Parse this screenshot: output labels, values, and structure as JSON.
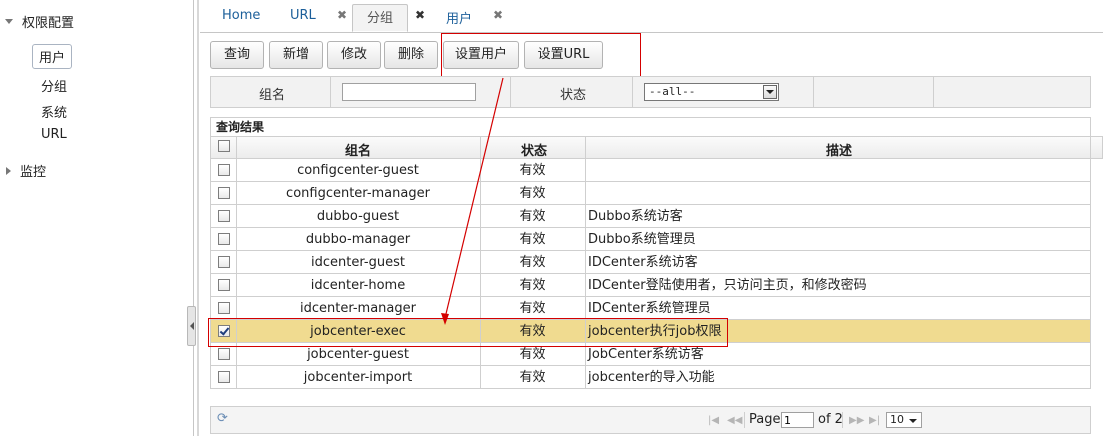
{
  "sidebar": {
    "groups": [
      {
        "label": "权限配置",
        "expanded": true,
        "items": [
          "用户",
          "分组",
          "系统",
          "URL"
        ],
        "selected": 0
      },
      {
        "label": "监控",
        "expanded": false
      }
    ]
  },
  "tabs": {
    "items": [
      {
        "label": "Home",
        "closable": false
      },
      {
        "label": "URL",
        "closable": true
      },
      {
        "label": "分组",
        "closable": true,
        "active": true
      },
      {
        "label": "用户",
        "closable": true
      }
    ],
    "close_glyph": "✖"
  },
  "toolbar": {
    "buttons": [
      "查询",
      "新增",
      "修改",
      "删除",
      "设置用户",
      "设置URL"
    ]
  },
  "filter": {
    "name_label": "组名",
    "name_value": "",
    "status_label": "状态",
    "status_value": "--all--"
  },
  "grid": {
    "title": "查询结果",
    "columns": [
      "组名",
      "状态",
      "描述"
    ],
    "rows": [
      {
        "name": "configcenter-guest",
        "status": "有效",
        "desc": "",
        "checked": false
      },
      {
        "name": "configcenter-manager",
        "status": "有效",
        "desc": "",
        "checked": false
      },
      {
        "name": "dubbo-guest",
        "status": "有效",
        "desc": "Dubbo系统访客",
        "checked": false
      },
      {
        "name": "dubbo-manager",
        "status": "有效",
        "desc": "Dubbo系统管理员",
        "checked": false
      },
      {
        "name": "idcenter-guest",
        "status": "有效",
        "desc": "IDCenter系统访客",
        "checked": false
      },
      {
        "name": "idcenter-home",
        "status": "有效",
        "desc": "IDCenter登陆使用者，只访问主页，和修改密码",
        "checked": false
      },
      {
        "name": "idcenter-manager",
        "status": "有效",
        "desc": "IDCenter系统管理员",
        "checked": false
      },
      {
        "name": "jobcenter-exec",
        "status": "有效",
        "desc": "jobcenter执行job权限",
        "checked": true
      },
      {
        "name": "jobcenter-guest",
        "status": "有效",
        "desc": "JobCenter系统访客",
        "checked": false
      },
      {
        "name": "jobcenter-import",
        "status": "有效",
        "desc": "jobcenter的导入功能",
        "checked": false
      }
    ]
  },
  "pager": {
    "page_label": "Page",
    "page_value": "1",
    "of_label": "of 2",
    "page_size": "10"
  },
  "colors": {
    "tab_text": "#1c5f9a",
    "selected_row": "#f0db90",
    "annotation": "#d40000"
  }
}
